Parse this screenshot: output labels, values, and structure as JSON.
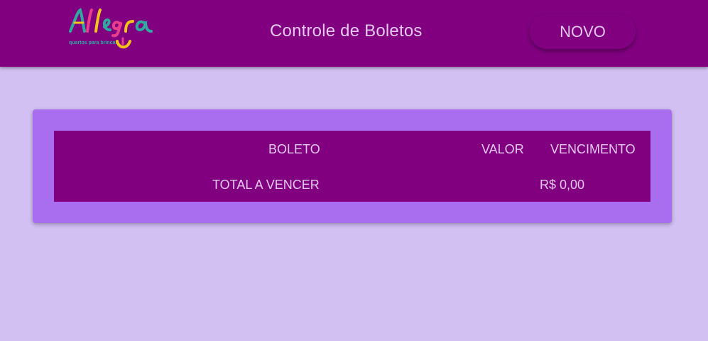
{
  "header": {
    "logo_text": "Allegra",
    "logo_tagline": "quartos para brincar",
    "title": "Controle de Boletos",
    "new_button_label": "NOVO"
  },
  "table": {
    "columns": [
      "BOLETO",
      "VALOR",
      "VENCIMENTO"
    ],
    "total_label": "TOTAL A VENCER",
    "total_value": "R$ 0,00"
  },
  "colors": {
    "header_bg": "#800080",
    "page_bg": "#d3c0f3",
    "card_bg": "#a96def",
    "text": "#e4c8f0"
  }
}
